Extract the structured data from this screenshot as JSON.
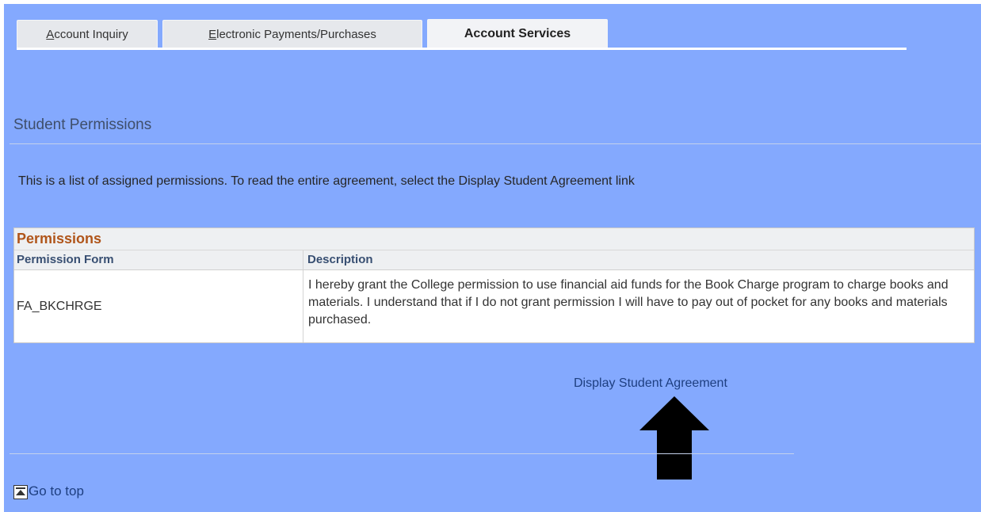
{
  "tabs": [
    {
      "label": "Account Inquiry",
      "access_key": "A",
      "rest": "ccount Inquiry",
      "active": false
    },
    {
      "label": "Electronic Payments/Purchases",
      "access_key": "E",
      "rest": "lectronic Payments/Purchases",
      "active": false
    },
    {
      "label": "Account Services",
      "active": true
    }
  ],
  "page": {
    "title": "Student Permissions",
    "instructions": "This is a list of assigned permissions. To read the entire agreement, select the Display Student Agreement link"
  },
  "grid": {
    "title": "Permissions",
    "columns": [
      "Permission Form",
      "Description"
    ],
    "rows": [
      {
        "form": "FA_BKCHRGE",
        "description": "I hereby grant the College permission to use financial aid funds for the Book Charge program to charge books and materials.  I understand that if I do not grant permission I will have to pay out of pocket for any books and materials purchased."
      }
    ]
  },
  "links": {
    "display_agreement": "Display Student Agreement",
    "go_to_top": "Go to top"
  },
  "colors": {
    "background": "#84a9fe",
    "grid_title": "#b0551a",
    "link": "#1e3f80"
  },
  "icons": {
    "go_top": "go-top-icon",
    "annotation_arrow": "up-arrow-icon"
  }
}
